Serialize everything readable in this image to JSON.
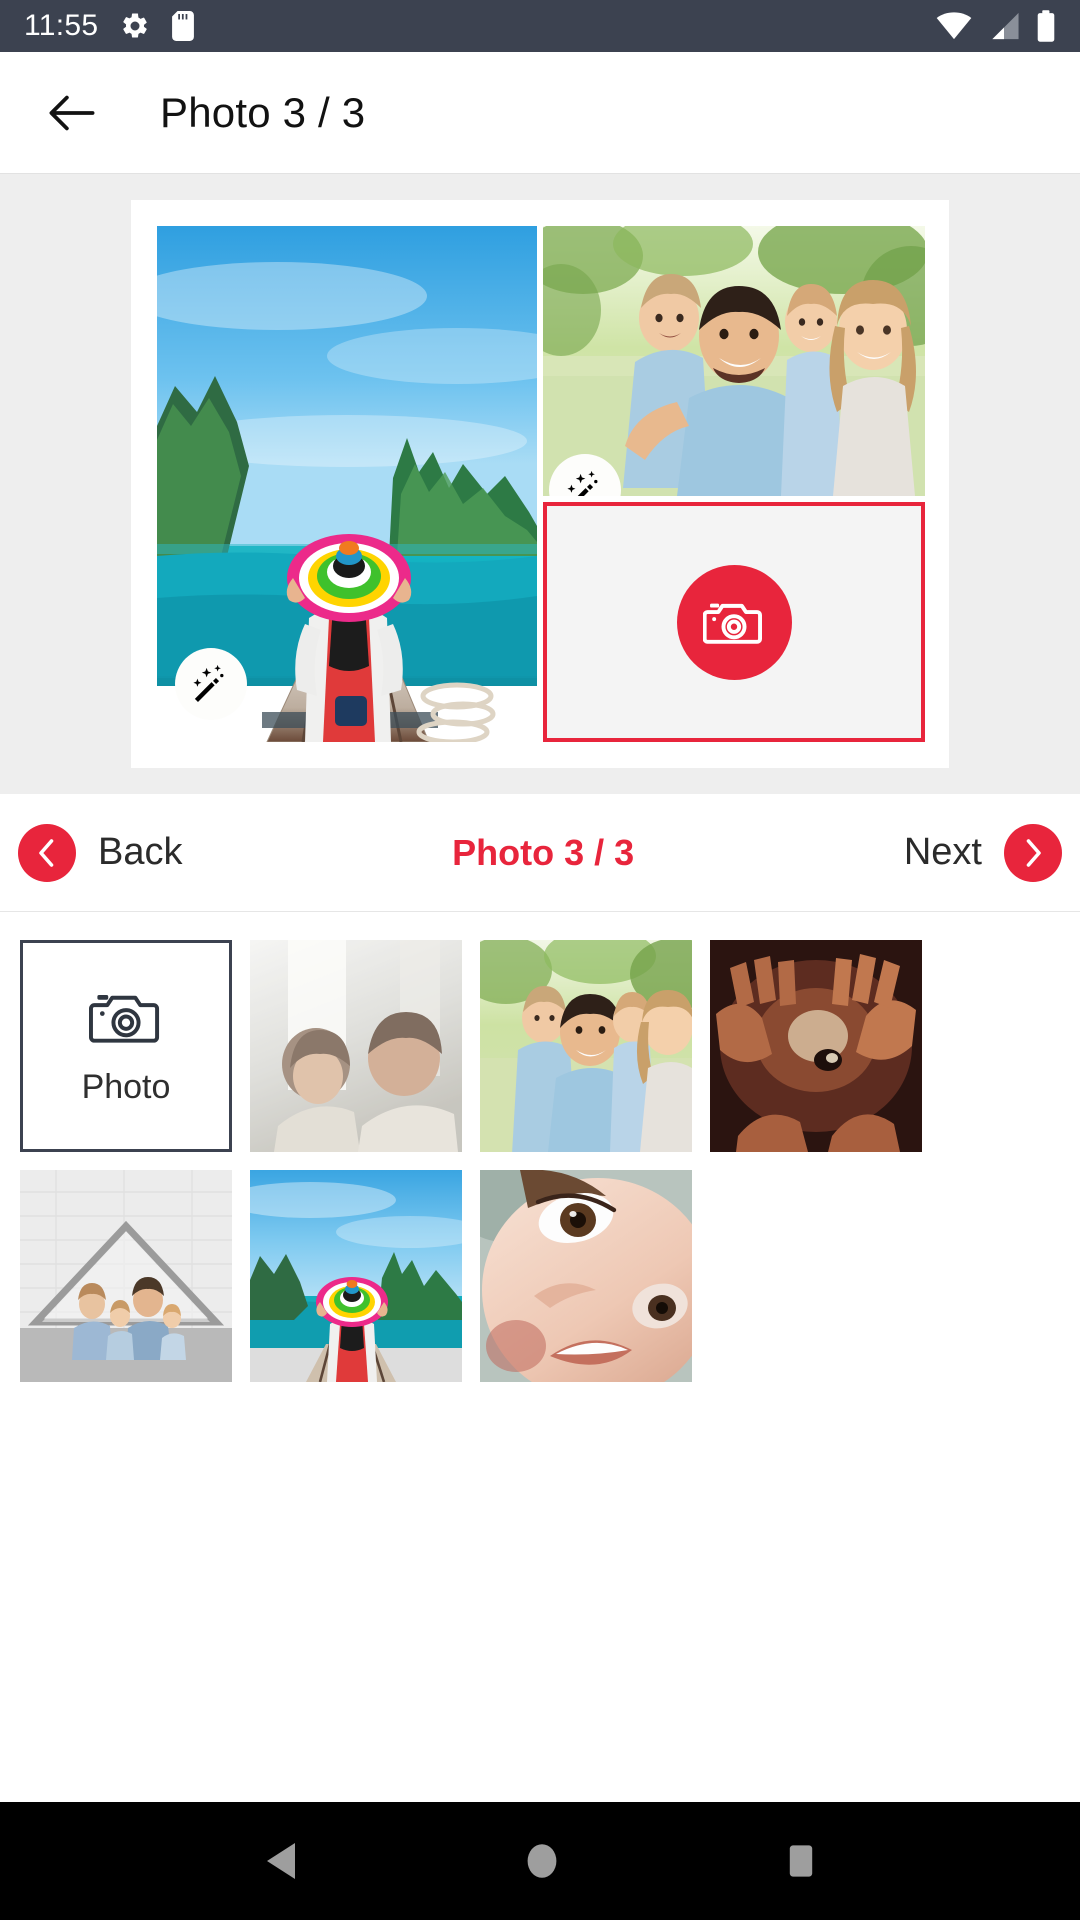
{
  "statusbar": {
    "time": "11:55",
    "left_icons": [
      "gear-icon",
      "sd-card-icon"
    ],
    "right_icons": [
      "wifi-icon",
      "cell-signal-icon",
      "battery-icon"
    ],
    "background": "#3c4250"
  },
  "appbar": {
    "back_icon": "arrow-left-icon",
    "title": "Photo 3 / 3"
  },
  "theme": {
    "accent": "#e8253c",
    "canvas_bg": "#eeeeee",
    "frame_bg": "#ffffff"
  },
  "collage": {
    "frame_label": "collage-canvas",
    "cells": [
      {
        "id": "cell-left",
        "name": "woman-in-rainbow-hat-on-boat",
        "filled": true,
        "edit_badge": "magic-wand-icon"
      },
      {
        "id": "cell-top-right",
        "name": "family-selfie-in-park",
        "filled": true,
        "edit_badge": "magic-wand-icon"
      },
      {
        "id": "cell-bottom-right",
        "name": "empty-photo-slot",
        "filled": false,
        "placeholder_icon": "camera-icon",
        "border_color": "#e8253c"
      }
    ]
  },
  "pager": {
    "back_label": "Back",
    "back_icon": "chevron-left-icon",
    "counter": "Photo 3 / 3",
    "next_label": "Next",
    "next_icon": "chevron-right-icon"
  },
  "thumbnails": {
    "add_tile": {
      "label": "Photo",
      "icon": "camera-icon"
    },
    "items": [
      {
        "name": "child-and-man-by-window",
        "alt": "child and man looking at each other by a sunlit window"
      },
      {
        "name": "family-selfie-in-park",
        "alt": "family of four taking a selfie in a park"
      },
      {
        "name": "hands-together-overhead",
        "alt": "group of hands reaching together seen from above"
      },
      {
        "name": "family-under-paper-house",
        "alt": "family sitting under a cardboard house shape"
      },
      {
        "name": "woman-in-rainbow-hat-on-boat",
        "alt": "woman in rainbow hat on a boat facing the sea"
      },
      {
        "name": "smiling-child-closeup",
        "alt": "close-up of a smiling child's face"
      }
    ]
  },
  "sysnav": {
    "buttons": [
      {
        "name": "android-back-button",
        "icon": "triangle-left-icon"
      },
      {
        "name": "android-home-button",
        "icon": "circle-icon"
      },
      {
        "name": "android-recents-button",
        "icon": "square-icon"
      }
    ]
  }
}
